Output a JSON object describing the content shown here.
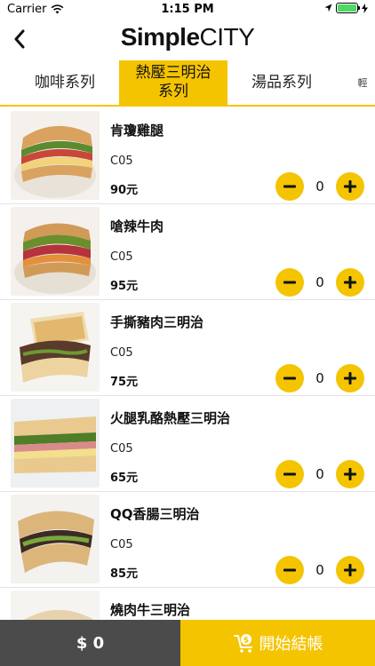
{
  "status_bar": {
    "carrier": "Carrier",
    "time": "1:15 PM"
  },
  "nav": {
    "title_bold": "Simple",
    "title_light": "CITY"
  },
  "tabs": [
    {
      "label": "咖啡系列",
      "active": false
    },
    {
      "label_line1": "熱壓三明治",
      "label_line2": "系列",
      "active": true
    },
    {
      "label": "湯品系列",
      "active": false
    },
    {
      "label": "輕",
      "active": false
    }
  ],
  "products": [
    {
      "name": "肯瓊雞腿",
      "code": "C05",
      "price": "90元",
      "quantity": "0"
    },
    {
      "name": "嗆辣牛肉",
      "code": "C05",
      "price": "95元",
      "quantity": "0"
    },
    {
      "name": "手撕豬肉三明治",
      "code": "C05",
      "price": "75元",
      "quantity": "0"
    },
    {
      "name": "火腿乳酪熱壓三明治",
      "code": "C05",
      "price": "65元",
      "quantity": "0"
    },
    {
      "name": "QQ香腸三明治",
      "code": "C05",
      "price": "85元",
      "quantity": "0"
    },
    {
      "name": "燒肉牛三明治",
      "code": "",
      "price": "",
      "quantity": ""
    }
  ],
  "bottom": {
    "total": "$ 0",
    "checkout_label": "開始結帳"
  },
  "colors": {
    "accent": "#f5c400",
    "bottom_dark": "#4b4b4b"
  },
  "icons": {
    "back": "chevron-left-icon",
    "minus": "minus-icon",
    "plus": "plus-icon",
    "cart": "cart-dollar-icon"
  }
}
